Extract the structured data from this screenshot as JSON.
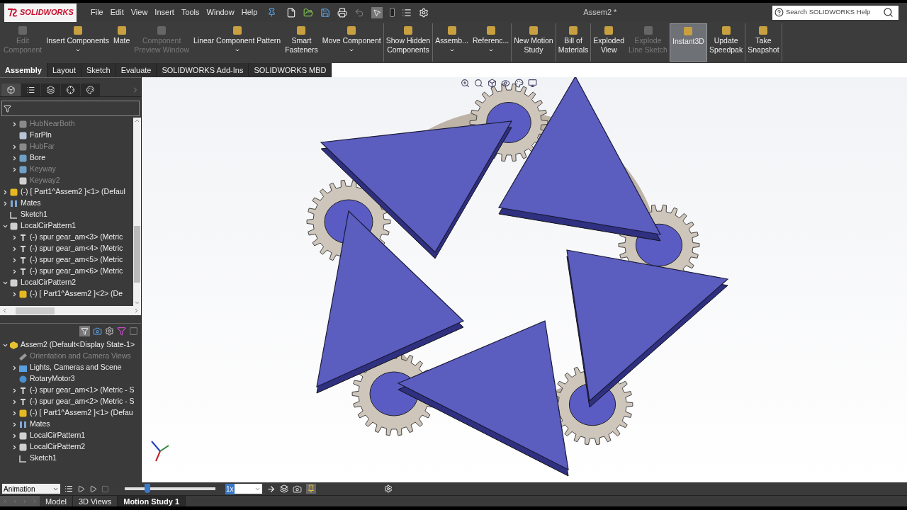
{
  "app": {
    "logo": "SOLIDWORKS",
    "menu": [
      "File",
      "Edit",
      "View",
      "Insert",
      "Tools",
      "Window",
      "Help"
    ],
    "title": "Assem2 *",
    "search": {
      "placeholder": "Search SOLIDWORKS Help"
    }
  },
  "ribbon": {
    "groups": [
      {
        "buttons": [
          {
            "label": "Edit\nComponent",
            "disabled": true,
            "selected": false,
            "dropdown": false
          },
          {
            "label": "Insert Components",
            "disabled": false,
            "selected": false,
            "dropdown": true
          },
          {
            "label": "Mate",
            "disabled": false,
            "selected": false,
            "dropdown": false
          },
          {
            "label": "Component\nPreview Window",
            "disabled": true,
            "selected": false,
            "dropdown": false
          },
          {
            "label": "Linear Component Pattern",
            "disabled": false,
            "selected": false,
            "dropdown": true
          },
          {
            "label": "Smart\nFasteners",
            "disabled": false,
            "selected": false,
            "dropdown": false
          },
          {
            "label": "Move Component",
            "disabled": false,
            "selected": false,
            "dropdown": true
          }
        ]
      },
      {
        "buttons": [
          {
            "label": "Show Hidden\nComponents",
            "disabled": false,
            "selected": false,
            "dropdown": false
          }
        ]
      },
      {
        "buttons": [
          {
            "label": "Assemb...",
            "disabled": false,
            "selected": false,
            "dropdown": true
          },
          {
            "label": "Referenc...",
            "disabled": false,
            "selected": false,
            "dropdown": true
          }
        ]
      },
      {
        "buttons": [
          {
            "label": "New Motion\nStudy",
            "disabled": false,
            "selected": false,
            "dropdown": false
          }
        ]
      },
      {
        "buttons": [
          {
            "label": "Bill of\nMaterials",
            "disabled": false,
            "selected": false,
            "dropdown": false
          }
        ]
      },
      {
        "buttons": [
          {
            "label": "Exploded\nView",
            "disabled": false,
            "selected": false,
            "dropdown": false
          },
          {
            "label": "Explode\nLine Sketch",
            "disabled": true,
            "selected": false,
            "dropdown": false
          },
          {
            "label": "Instant3D",
            "disabled": false,
            "selected": true,
            "dropdown": false
          },
          {
            "label": "Update\nSpeedpak",
            "disabled": false,
            "selected": false,
            "dropdown": false
          }
        ]
      },
      {
        "buttons": [
          {
            "label": "Take\nSnapshot",
            "disabled": false,
            "selected": false,
            "dropdown": false
          }
        ]
      }
    ]
  },
  "command_tabs": [
    {
      "label": "Assembly",
      "selected": true
    },
    {
      "label": "Layout",
      "selected": false
    },
    {
      "label": "Sketch",
      "selected": false
    },
    {
      "label": "Evaluate",
      "selected": false
    },
    {
      "label": "SOLIDWORKS Add-Ins",
      "selected": false
    },
    {
      "label": "SOLIDWORKS MBD",
      "selected": false
    }
  ],
  "feature_tree": {
    "partial_children": [
      {
        "label": "HubNearBoth",
        "kind": "feature",
        "disabled": true,
        "expanded": false
      },
      {
        "label": "FarPln",
        "kind": "plane",
        "disabled": false
      },
      {
        "label": "HubFar",
        "kind": "feature",
        "disabled": true,
        "expanded": false
      },
      {
        "label": "Bore",
        "kind": "cut",
        "disabled": false,
        "expanded": false
      },
      {
        "label": "Keyway",
        "kind": "cut",
        "disabled": true,
        "expanded": false
      },
      {
        "label": "Keyway2",
        "kind": "pattern",
        "disabled": true
      }
    ],
    "items": [
      {
        "label": "(-) [ Part1^Assem2 ]<1> (Defaul",
        "kind": "part",
        "disabled": false,
        "expanded": false
      },
      {
        "label": "Mates",
        "kind": "mates",
        "disabled": false,
        "expanded": false
      },
      {
        "label": "Sketch1",
        "kind": "sketch",
        "disabled": false
      },
      {
        "label": "LocalCirPattern1",
        "kind": "pattern",
        "disabled": false,
        "expanded": true,
        "children": [
          {
            "label": "(-) spur gear_am<3> (Metric",
            "kind": "gear",
            "disabled": false,
            "expanded": false
          },
          {
            "label": "(-) spur gear_am<4> (Metric",
            "kind": "gear",
            "disabled": false,
            "expanded": false
          },
          {
            "label": "(-) spur gear_am<5> (Metric",
            "kind": "gear",
            "disabled": false,
            "expanded": false
          },
          {
            "label": "(-) spur gear_am<6> (Metric",
            "kind": "gear",
            "disabled": false,
            "expanded": false
          }
        ]
      },
      {
        "label": "LocalCirPattern2",
        "kind": "pattern",
        "disabled": false,
        "expanded": true,
        "children": [
          {
            "label": "(-) [ Part1^Assem2 ]<2> (De",
            "kind": "part",
            "disabled": false,
            "expanded": false
          }
        ]
      }
    ]
  },
  "motion_tree": {
    "items": [
      {
        "label": "Assem2  (Default<Display State-1>",
        "kind": "assembly",
        "disabled": false,
        "expanded": true,
        "children": [
          {
            "label": "Orientation and Camera Views",
            "kind": "camera",
            "disabled": true
          },
          {
            "label": "Lights, Cameras and Scene",
            "kind": "lights",
            "disabled": false,
            "expanded": false
          },
          {
            "label": "RotaryMotor3",
            "kind": "motor",
            "disabled": false
          },
          {
            "label": "(-) spur gear_am<1> (Metric - S",
            "kind": "gear",
            "disabled": false,
            "expanded": false
          },
          {
            "label": "(-) spur gear_am<2> (Metric - S",
            "kind": "gear",
            "disabled": false,
            "expanded": false
          },
          {
            "label": "(-) [ Part1^Assem2 ]<1> (Defau",
            "kind": "part",
            "disabled": false,
            "expanded": false
          },
          {
            "label": "Mates",
            "kind": "mates",
            "disabled": false,
            "expanded": false
          },
          {
            "label": "LocalCirPattern1",
            "kind": "pattern",
            "disabled": false,
            "expanded": false
          },
          {
            "label": "LocalCirPattern2",
            "kind": "pattern",
            "disabled": false,
            "expanded": false
          },
          {
            "label": "Sketch1",
            "kind": "sketch",
            "disabled": false
          }
        ]
      }
    ]
  },
  "motion_bar": {
    "study_type": "Animation",
    "timeline": {
      "level": 0.25
    },
    "speed": "1x"
  },
  "bottom_tabs": [
    {
      "label": "Model",
      "selected": false
    },
    {
      "label": "3D Views",
      "selected": false
    },
    {
      "label": "Motion Study 1",
      "selected": true
    }
  ]
}
